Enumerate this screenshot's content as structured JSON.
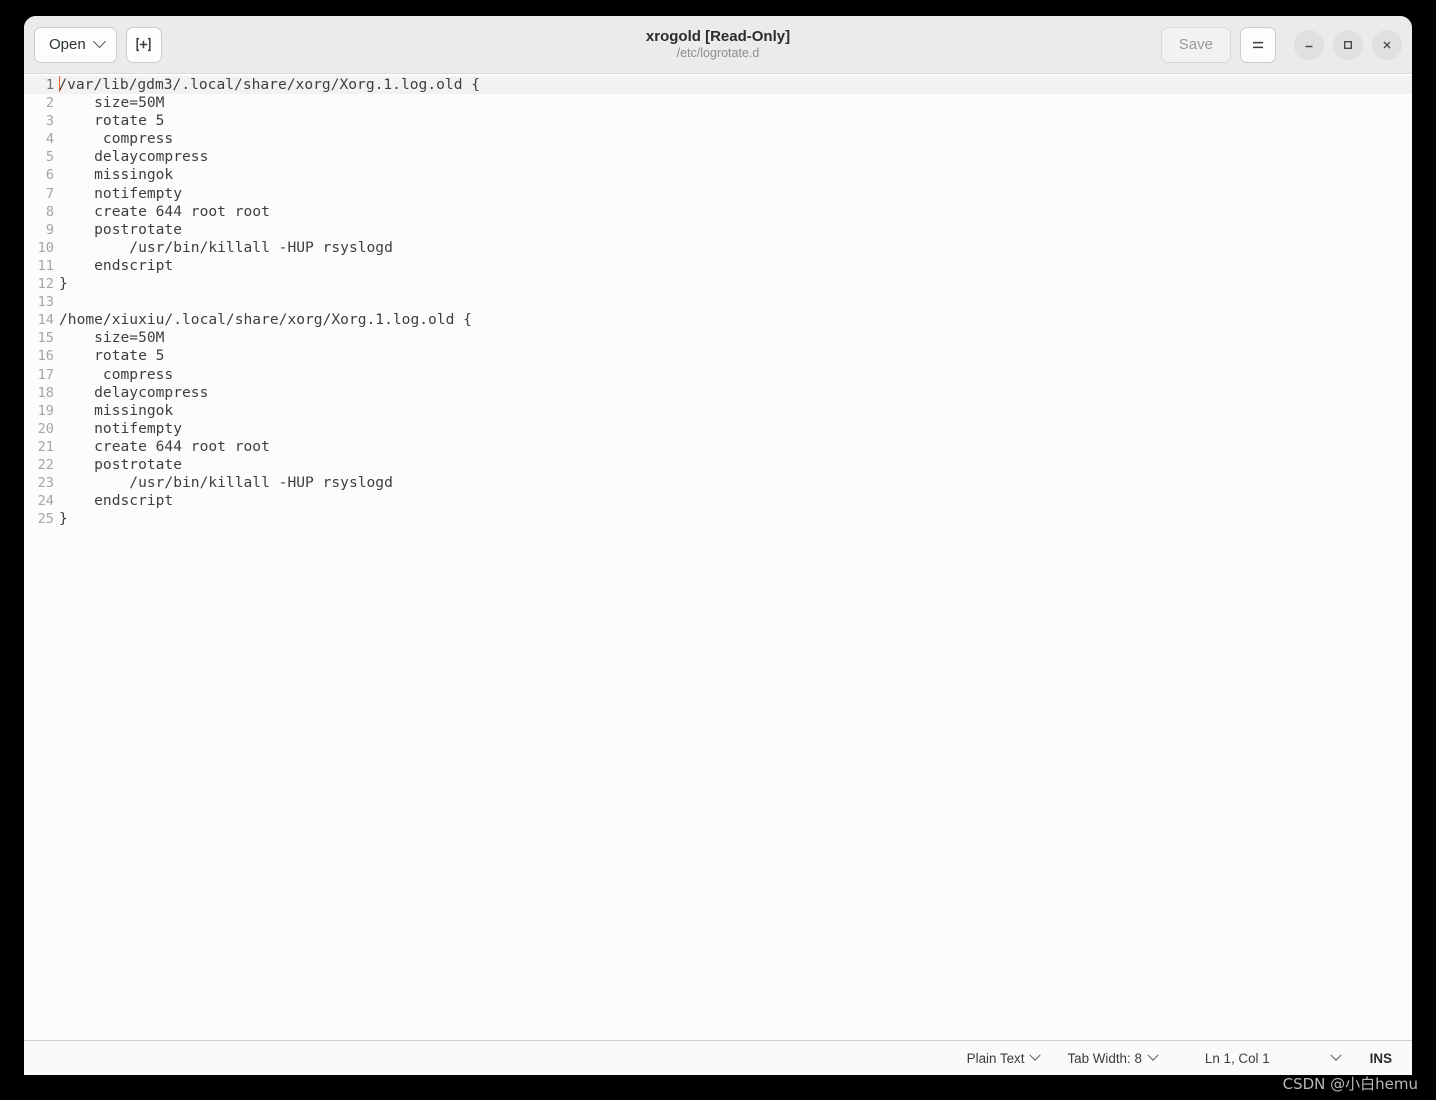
{
  "window": {
    "title": "xrogold [Read-Only]",
    "subtitle": "/etc/logrotate.d"
  },
  "toolbar": {
    "open_label": "Open",
    "new_tab_icon": "new-document-icon",
    "save_label": "Save",
    "menu_icon": "hamburger-menu-icon",
    "minimize_icon": "minimize-icon",
    "maximize_icon": "maximize-icon",
    "close_icon": "close-icon"
  },
  "editor": {
    "cursor_line": 1,
    "cursor_color": "#e8622a",
    "lines": [
      {
        "n": "1",
        "text": "/var/lib/gdm3/.local/share/xorg/Xorg.1.log.old {"
      },
      {
        "n": "2",
        "text": "    size=50M"
      },
      {
        "n": "3",
        "text": "    rotate 5"
      },
      {
        "n": "4",
        "text": "     compress"
      },
      {
        "n": "5",
        "text": "    delaycompress"
      },
      {
        "n": "6",
        "text": "    missingok"
      },
      {
        "n": "7",
        "text": "    notifempty"
      },
      {
        "n": "8",
        "text": "    create 644 root root"
      },
      {
        "n": "9",
        "text": "    postrotate"
      },
      {
        "n": "10",
        "text": "        /usr/bin/killall -HUP rsyslogd"
      },
      {
        "n": "11",
        "text": "    endscript"
      },
      {
        "n": "12",
        "text": "}"
      },
      {
        "n": "13",
        "text": ""
      },
      {
        "n": "14",
        "text": "/home/xiuxiu/.local/share/xorg/Xorg.1.log.old {"
      },
      {
        "n": "15",
        "text": "    size=50M"
      },
      {
        "n": "16",
        "text": "    rotate 5"
      },
      {
        "n": "17",
        "text": "     compress"
      },
      {
        "n": "18",
        "text": "    delaycompress"
      },
      {
        "n": "19",
        "text": "    missingok"
      },
      {
        "n": "20",
        "text": "    notifempty"
      },
      {
        "n": "21",
        "text": "    create 644 root root"
      },
      {
        "n": "22",
        "text": "    postrotate"
      },
      {
        "n": "23",
        "text": "        /usr/bin/killall -HUP rsyslogd"
      },
      {
        "n": "24",
        "text": "    endscript"
      },
      {
        "n": "25",
        "text": "}"
      }
    ]
  },
  "statusbar": {
    "language": "Plain Text",
    "tab_width": "Tab Width: 8",
    "position": "Ln 1, Col 1",
    "insert_mode": "INS"
  },
  "watermark": "CSDN @小白hemu",
  "colors": {
    "headerbar": "#ebebeb",
    "editor_bg": "#fcfcfc",
    "current_line": "#f3f2f0",
    "text": "#3b3f42",
    "line_number": "#a5a5a5",
    "desktop": "#000000"
  }
}
